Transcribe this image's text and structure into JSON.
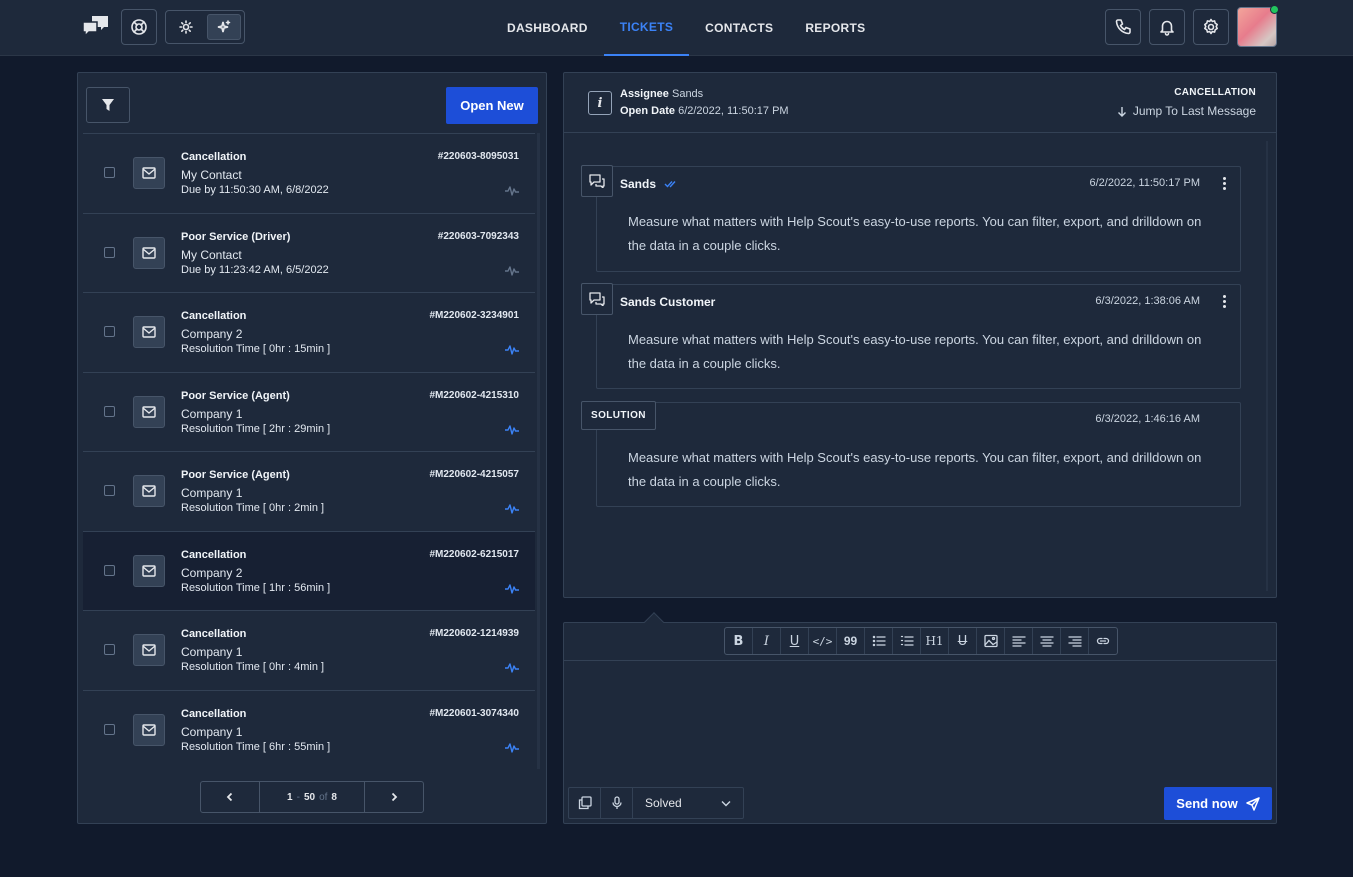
{
  "nav": {
    "items": [
      {
        "label": "DASHBOARD",
        "active": false
      },
      {
        "label": "TICKETS",
        "active": true
      },
      {
        "label": "CONTACTS",
        "active": false
      },
      {
        "label": "REPORTS",
        "active": false
      }
    ]
  },
  "toolbar_icons": [
    "chat-logo-icon",
    "lifebuoy-icon",
    "sun-icon",
    "sparkle-icon",
    "phone-icon",
    "bell-icon",
    "gear-icon",
    "avatar"
  ],
  "left": {
    "open_new_label": "Open New",
    "tickets": [
      {
        "title": "Cancellation",
        "contact": "My Contact",
        "meta": "Due by 11:50:30 AM, 6/8/2022",
        "id": "#220603-8095031",
        "active_pulse": false,
        "selected": false
      },
      {
        "title": "Poor Service (Driver)",
        "contact": "My Contact",
        "meta": "Due by 11:23:42 AM, 6/5/2022",
        "id": "#220603-7092343",
        "active_pulse": false,
        "selected": false
      },
      {
        "title": "Cancellation",
        "contact": "Company 2",
        "meta": "Resolution Time [ 0hr : 15min ]",
        "id": "#M220602-3234901",
        "active_pulse": true,
        "selected": false
      },
      {
        "title": "Poor Service (Agent)",
        "contact": "Company 1",
        "meta": "Resolution Time [ 2hr : 29min ]",
        "id": "#M220602-4215310",
        "active_pulse": true,
        "selected": false
      },
      {
        "title": "Poor Service (Agent)",
        "contact": "Company 1",
        "meta": "Resolution Time [ 0hr : 2min ]",
        "id": "#M220602-4215057",
        "active_pulse": true,
        "selected": false
      },
      {
        "title": "Cancellation",
        "contact": "Company 2",
        "meta": "Resolution Time [ 1hr : 56min ]",
        "id": "#M220602-6215017",
        "active_pulse": true,
        "selected": true
      },
      {
        "title": "Cancellation",
        "contact": "Company 1",
        "meta": "Resolution Time [ 0hr : 4min ]",
        "id": "#M220602-1214939",
        "active_pulse": true,
        "selected": false
      },
      {
        "title": "Cancellation",
        "contact": "Company 1",
        "meta": "Resolution Time [ 6hr : 55min ]",
        "id": "#M220601-3074340",
        "active_pulse": true,
        "selected": false
      }
    ],
    "pager": {
      "from": "1",
      "sep": "-",
      "to": "50",
      "of_label": "of",
      "total": "8"
    }
  },
  "conversation": {
    "assignee_label": "Assignee",
    "assignee_value": "Sands",
    "open_date_label": "Open Date",
    "open_date_value": "6/2/2022, 11:50:17 PM",
    "category": "CANCELLATION",
    "jump_label": "Jump To Last Message",
    "messages": [
      {
        "sender": "Sands",
        "time": "6/2/2022, 11:50:17 PM",
        "body": "Measure what matters with Help Scout's easy-to-use reports. You can filter, export, and drilldown on the data in a couple clicks."
      },
      {
        "sender": "Sands Customer",
        "time": "6/3/2022, 1:38:06 AM",
        "body": "Measure what matters with Help Scout's easy-to-use reports. You can filter, export, and drilldown on the data in a couple clicks."
      },
      {
        "badge": "SOLUTION",
        "time": "6/3/2022, 1:46:16 AM",
        "body": "Measure what matters with Help Scout's easy-to-use reports. You can filter, export, and drilldown on the data in a couple clicks."
      }
    ]
  },
  "editor": {
    "toolbar": [
      {
        "name": "bold",
        "glyph": "B"
      },
      {
        "name": "italic",
        "glyph": "I"
      },
      {
        "name": "underline",
        "glyph": "U"
      },
      {
        "name": "code",
        "glyph": "</>"
      },
      {
        "name": "quote",
        "glyph": "99"
      },
      {
        "name": "bullet-list",
        "glyph": ""
      },
      {
        "name": "ordered-list",
        "glyph": ""
      },
      {
        "name": "heading",
        "glyph": "H1"
      },
      {
        "name": "strikethrough",
        "glyph": "U"
      },
      {
        "name": "image",
        "glyph": ""
      },
      {
        "name": "align-left",
        "glyph": ""
      },
      {
        "name": "align-center",
        "glyph": ""
      },
      {
        "name": "align-right",
        "glyph": ""
      },
      {
        "name": "link",
        "glyph": ""
      }
    ],
    "status_value": "Solved",
    "send_label": "Send now"
  },
  "colors": {
    "accent": "#1d4ed8",
    "link": "#3b82f6",
    "bg": "#111a2c",
    "panel": "#1e293b"
  }
}
